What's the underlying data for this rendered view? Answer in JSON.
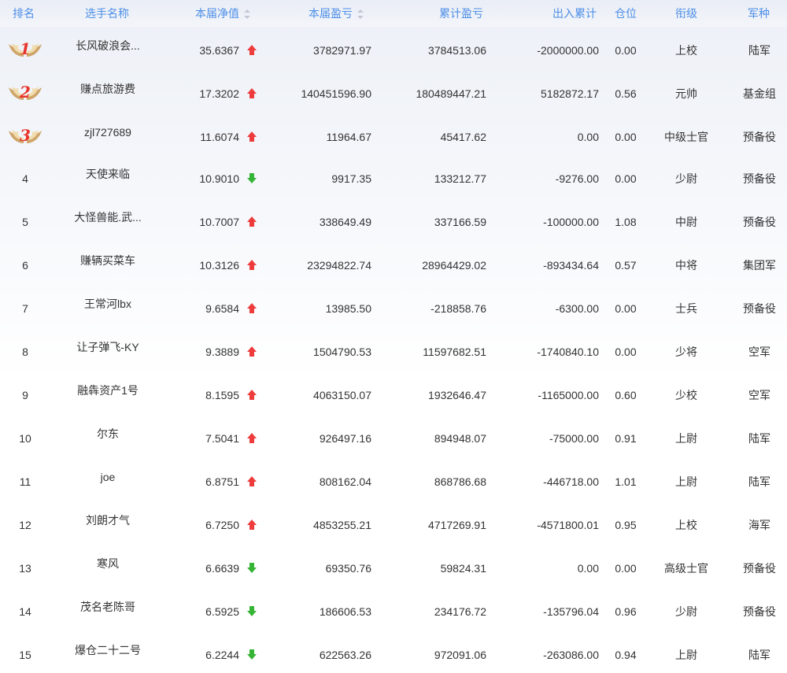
{
  "header": {
    "rank": "排名",
    "name": "选手名称",
    "nav": "本届净值",
    "pl": "本届盈亏",
    "cum": "累计盈亏",
    "flow": "出入累计",
    "pos": "仓位",
    "grade": "衔级",
    "arm": "军种"
  },
  "colors": {
    "header_text": "#4d8fe8",
    "up": "#ee3b3b",
    "down": "#36b436",
    "medal_gold": "#c9a56a"
  },
  "rows": [
    {
      "rank": "1",
      "medal": true,
      "name": "长风破浪会...",
      "nav": "35.6367",
      "trend": "up",
      "pl": "3782971.97",
      "cum": "3784513.06",
      "flow": "-2000000.00",
      "pos": "0.00",
      "grade": "上校",
      "arm": "陆军"
    },
    {
      "rank": "2",
      "medal": true,
      "name": "赚点旅游费",
      "nav": "17.3202",
      "trend": "up",
      "pl": "140451596.90",
      "cum": "180489447.21",
      "flow": "5182872.17",
      "pos": "0.56",
      "grade": "元帅",
      "arm": "基金组"
    },
    {
      "rank": "3",
      "medal": true,
      "name": "zjl727689",
      "nav": "11.6074",
      "trend": "up",
      "pl": "11964.67",
      "cum": "45417.62",
      "flow": "0.00",
      "pos": "0.00",
      "grade": "中级士官",
      "arm": "预备役"
    },
    {
      "rank": "4",
      "medal": false,
      "name": "天使来临",
      "nav": "10.9010",
      "trend": "down",
      "pl": "9917.35",
      "cum": "133212.77",
      "flow": "-9276.00",
      "pos": "0.00",
      "grade": "少尉",
      "arm": "预备役"
    },
    {
      "rank": "5",
      "medal": false,
      "name": "大怪兽能.武...",
      "nav": "10.7007",
      "trend": "up",
      "pl": "338649.49",
      "cum": "337166.59",
      "flow": "-100000.00",
      "pos": "1.08",
      "grade": "中尉",
      "arm": "预备役"
    },
    {
      "rank": "6",
      "medal": false,
      "name": "赚辆买菜车",
      "nav": "10.3126",
      "trend": "up",
      "pl": "23294822.74",
      "cum": "28964429.02",
      "flow": "-893434.64",
      "pos": "0.57",
      "grade": "中将",
      "arm": "集团军"
    },
    {
      "rank": "7",
      "medal": false,
      "name": "王常河lbx",
      "nav": "9.6584",
      "trend": "up",
      "pl": "13985.50",
      "cum": "-218858.76",
      "flow": "-6300.00",
      "pos": "0.00",
      "grade": "士兵",
      "arm": "预备役"
    },
    {
      "rank": "8",
      "medal": false,
      "name": "让子弹飞-KY",
      "nav": "9.3889",
      "trend": "up",
      "pl": "1504790.53",
      "cum": "11597682.51",
      "flow": "-1740840.10",
      "pos": "0.00",
      "grade": "少将",
      "arm": "空军"
    },
    {
      "rank": "9",
      "medal": false,
      "name": "融犇资产1号",
      "nav": "8.1595",
      "trend": "up",
      "pl": "4063150.07",
      "cum": "1932646.47",
      "flow": "-1165000.00",
      "pos": "0.60",
      "grade": "少校",
      "arm": "空军"
    },
    {
      "rank": "10",
      "medal": false,
      "name": "尔东",
      "nav": "7.5041",
      "trend": "up",
      "pl": "926497.16",
      "cum": "894948.07",
      "flow": "-75000.00",
      "pos": "0.91",
      "grade": "上尉",
      "arm": "陆军"
    },
    {
      "rank": "11",
      "medal": false,
      "name": "joe",
      "nav": "6.8751",
      "trend": "up",
      "pl": "808162.04",
      "cum": "868786.68",
      "flow": "-446718.00",
      "pos": "1.01",
      "grade": "上尉",
      "arm": "陆军"
    },
    {
      "rank": "12",
      "medal": false,
      "name": "刘朗才气",
      "nav": "6.7250",
      "trend": "up",
      "pl": "4853255.21",
      "cum": "4717269.91",
      "flow": "-4571800.01",
      "pos": "0.95",
      "grade": "上校",
      "arm": "海军"
    },
    {
      "rank": "13",
      "medal": false,
      "name": "寒风",
      "nav": "6.6639",
      "trend": "down",
      "pl": "69350.76",
      "cum": "59824.31",
      "flow": "0.00",
      "pos": "0.00",
      "grade": "高级士官",
      "arm": "预备役"
    },
    {
      "rank": "14",
      "medal": false,
      "name": "茂名老陈哥",
      "nav": "6.5925",
      "trend": "down",
      "pl": "186606.53",
      "cum": "234176.72",
      "flow": "-135796.04",
      "pos": "0.96",
      "grade": "少尉",
      "arm": "预备役"
    },
    {
      "rank": "15",
      "medal": false,
      "name": "爆仓二十二号",
      "nav": "6.2244",
      "trend": "down",
      "pl": "622563.26",
      "cum": "972091.06",
      "flow": "-263086.00",
      "pos": "0.94",
      "grade": "上尉",
      "arm": "陆军"
    }
  ]
}
